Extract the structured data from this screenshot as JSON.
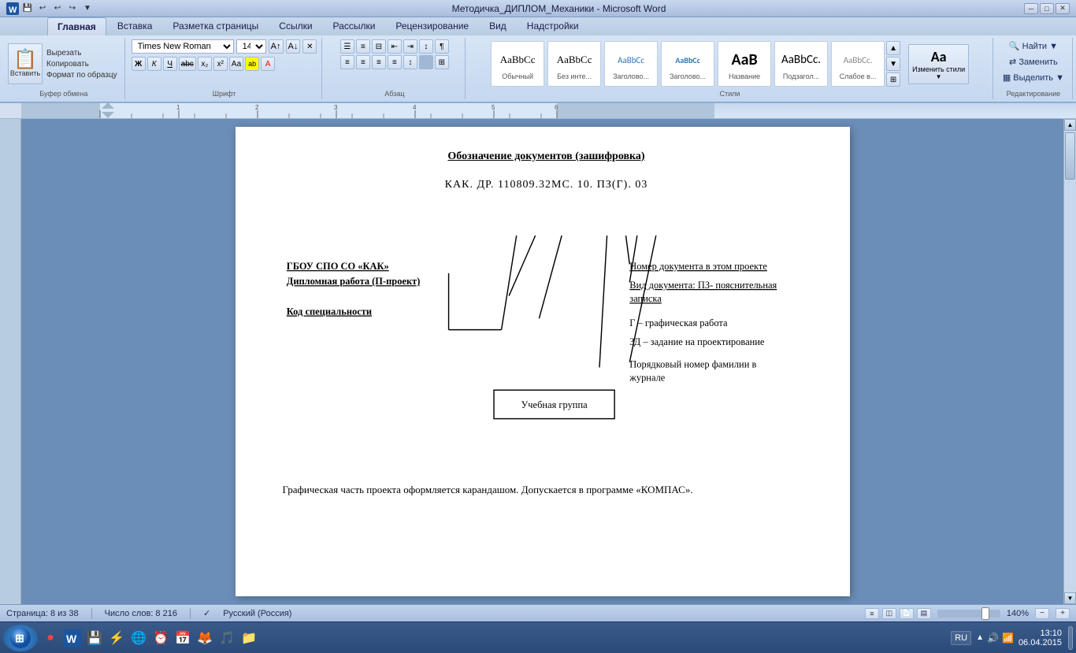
{
  "titlebar": {
    "title": "Методичка_ДИПЛОМ_Механики - Microsoft Word",
    "minimize": "─",
    "restore": "□",
    "close": "✕"
  },
  "quickaccess": {
    "save": "💾",
    "undo": "↩",
    "redo": "↪",
    "more": "▼"
  },
  "ribbon": {
    "tabs": [
      {
        "label": "Главная",
        "active": true
      },
      {
        "label": "Вставка",
        "active": false
      },
      {
        "label": "Разметка страницы",
        "active": false
      },
      {
        "label": "Ссылки",
        "active": false
      },
      {
        "label": "Рассылки",
        "active": false
      },
      {
        "label": "Рецензирование",
        "active": false
      },
      {
        "label": "Вид",
        "active": false
      },
      {
        "label": "Надстройки",
        "active": false
      }
    ],
    "clipboard": {
      "label": "Буфер обмена",
      "paste": "Вставить",
      "cut": "Вырезать",
      "copy": "Копировать",
      "format": "Формат по образцу"
    },
    "font": {
      "label": "Шрифт",
      "name": "Times New Roman",
      "size": "14",
      "bold": "Ж",
      "italic": "К",
      "underline": "Ч",
      "strikethrough": "abc",
      "subscript": "х₂",
      "superscript": "х²",
      "case": "Аа",
      "highlight": "ab",
      "color": "А"
    },
    "paragraph": {
      "label": "Абзац"
    },
    "styles": {
      "label": "Стили",
      "items": [
        {
          "name": "Обычный",
          "preview": "AaBbCс"
        },
        {
          "name": "Без инте...",
          "preview": "AaBbCс"
        },
        {
          "name": "Заголово...",
          "preview": "AaBbCс"
        },
        {
          "name": "Заголово...",
          "preview": "AaBbCс"
        },
        {
          "name": "Название",
          "preview": "AaBbCc"
        },
        {
          "name": "Подзагол...",
          "preview": "AaBbCc"
        },
        {
          "name": "Слабое в...",
          "preview": "AaBbCc"
        }
      ],
      "change_styles": "Изменить стили"
    },
    "editing": {
      "label": "Редактирование",
      "find": "Найти",
      "replace": "Заменить",
      "select": "Выделить"
    }
  },
  "document": {
    "title": "Обозначение документов (зашифровка)",
    "code": "КАК. ДР. 110809.32МС. 10. ПЗ(Г). 03",
    "labels": {
      "org": "ГБОУ СПО СО «КАК»",
      "work": "Дипломная работа (П-проект)",
      "specialty": "Код специальности",
      "doc_number": "Номер документа в этом проекте",
      "doc_type": "Вид документа: ПЗ- пояснительная записка",
      "graphic": "Г – графическая работа",
      "assignment": "ЗД – задание на проектирование",
      "order": "Порядковый номер фамилии в журнале",
      "group_box": "Учебная группа"
    },
    "footer_text": "Графическая часть проекта оформляется карандашом. Допускается в программе «КОМПАС»."
  },
  "statusbar": {
    "page": "Страница: 8 из 38",
    "words": "Число слов: 8 216",
    "lang": "Русский (Россия)",
    "zoom_percent": "140%"
  },
  "taskbar": {
    "clock": "13:10",
    "date": "06.04.2015",
    "lang": "RU"
  }
}
